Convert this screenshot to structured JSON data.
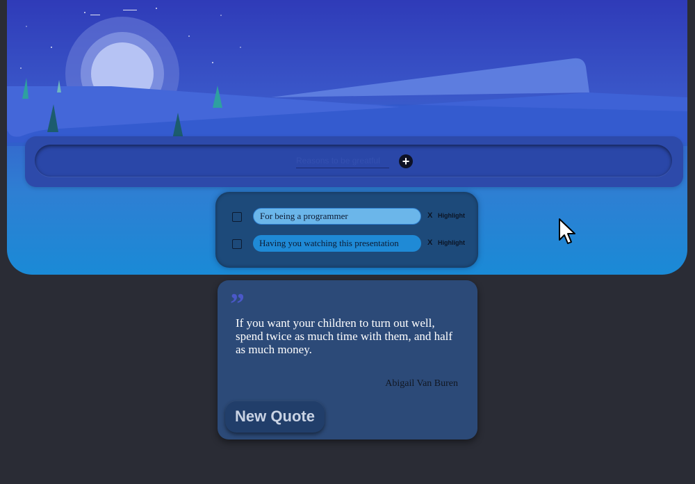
{
  "input_bar": {
    "placeholder": "Reasons to be greatful",
    "add_icon": "plus-circle-icon",
    "add_label": "+"
  },
  "todos": [
    {
      "text": "For being a programmer",
      "remove_label": "X",
      "highlight_label": "Highlight"
    },
    {
      "text": "Having you watching this presentation",
      "remove_label": "X",
      "highlight_label": "Highlight"
    }
  ],
  "quote": {
    "mark": "”",
    "text": "If you want your children to turn out well, spend twice as much time with them, and half as much money.",
    "author": "Abigail Van Buren",
    "button_label": "New Quote"
  },
  "colors": {
    "background": "#2a2c35",
    "sky_top": "#2f3bb8",
    "sky_bottom": "#1a8ad6",
    "card": "#2c4a78"
  },
  "icons": [
    "moon-icon",
    "tree-icon",
    "star-icon",
    "quote-mark-icon",
    "mouse-pointer-icon"
  ]
}
